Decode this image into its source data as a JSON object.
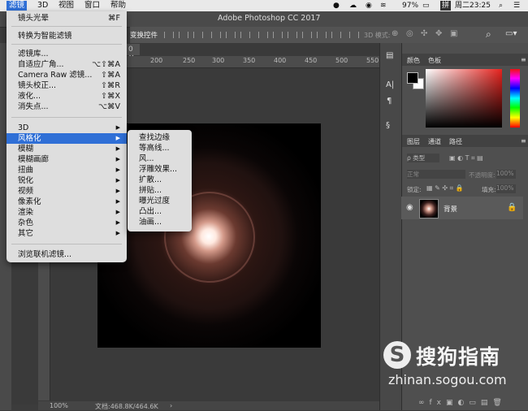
{
  "menubar": {
    "apple": "",
    "items": [
      "滤镜",
      "3D",
      "视图",
      "窗口",
      "帮助"
    ],
    "battery": "97%",
    "input": "拼",
    "clock": "周二23:25"
  },
  "window": {
    "title": "Adobe Photoshop CC 2017"
  },
  "options_bar": {
    "transform_label": "变换控件",
    "mode_3d": "3D 模式:"
  },
  "doc_tab": "0 ×",
  "ruler": [
    "200",
    "250",
    "300",
    "350",
    "400",
    "450",
    "500",
    "550"
  ],
  "status": {
    "zoom": "100%",
    "doc": "文档:468.8K/464.6K"
  },
  "filter_menu": {
    "items": [
      {
        "label": "镜头光晕",
        "shortcut": "⌘F"
      },
      {
        "label": "转换为智能滤镜"
      },
      {
        "label": "滤镜库..."
      },
      {
        "label": "自适应广角...",
        "shortcut": "⌥⇧⌘A"
      },
      {
        "label": "Camera Raw 滤镜...",
        "shortcut": "⇧⌘A"
      },
      {
        "label": "镜头校正...",
        "shortcut": "⇧⌘R"
      },
      {
        "label": "液化...",
        "shortcut": "⇧⌘X"
      },
      {
        "label": "消失点...",
        "shortcut": "⌥⌘V"
      },
      {
        "label": "3D"
      },
      {
        "label": "风格化"
      },
      {
        "label": "模糊"
      },
      {
        "label": "模糊画廊"
      },
      {
        "label": "扭曲"
      },
      {
        "label": "锐化"
      },
      {
        "label": "视频"
      },
      {
        "label": "像素化"
      },
      {
        "label": "渲染"
      },
      {
        "label": "杂色"
      },
      {
        "label": "其它"
      },
      {
        "label": "浏览联机滤镜..."
      }
    ]
  },
  "stylize_submenu": [
    "查找边缘",
    "等高线...",
    "风...",
    "浮雕效果...",
    "扩散...",
    "拼贴...",
    "曝光过度",
    "凸出...",
    "油画..."
  ],
  "panels": {
    "color_tabs": [
      "颜色",
      "色板"
    ],
    "layer_tabs": [
      "图层",
      "通道",
      "路径"
    ],
    "kind_label": "ρ 类型",
    "blend_mode": "正常",
    "opacity_label": "不透明度:",
    "opacity_value": "100%",
    "lock_label": "锁定:",
    "fill_label": "填充:",
    "fill_value": "100%",
    "layer_name": "背景"
  },
  "watermark": {
    "brand": "搜狗指南",
    "url": "zhinan.sogou.com"
  },
  "colors": {
    "highlight": "#2f6fd6",
    "menu_bg": "#dedede",
    "ps_dark": "#3c3c3c"
  }
}
